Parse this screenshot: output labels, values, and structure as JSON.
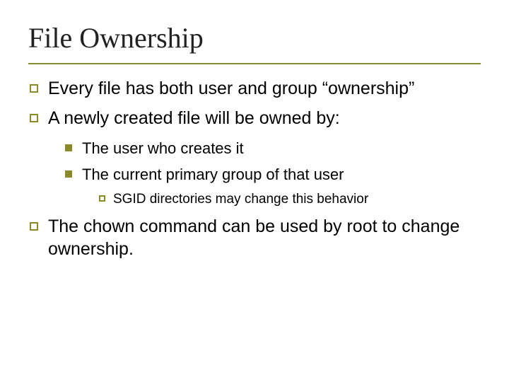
{
  "title": "File Ownership",
  "bullets": {
    "b1": "Every file has both user and group “ownership”",
    "b2": "A newly created file will be owned by:",
    "b2_sub": {
      "s1": "The user who creates it",
      "s2": "The current primary group of that user",
      "s2_sub": {
        "t1": "SGID directories may change this behavior"
      }
    },
    "b3": "The chown command can be used by root to change ownership."
  }
}
